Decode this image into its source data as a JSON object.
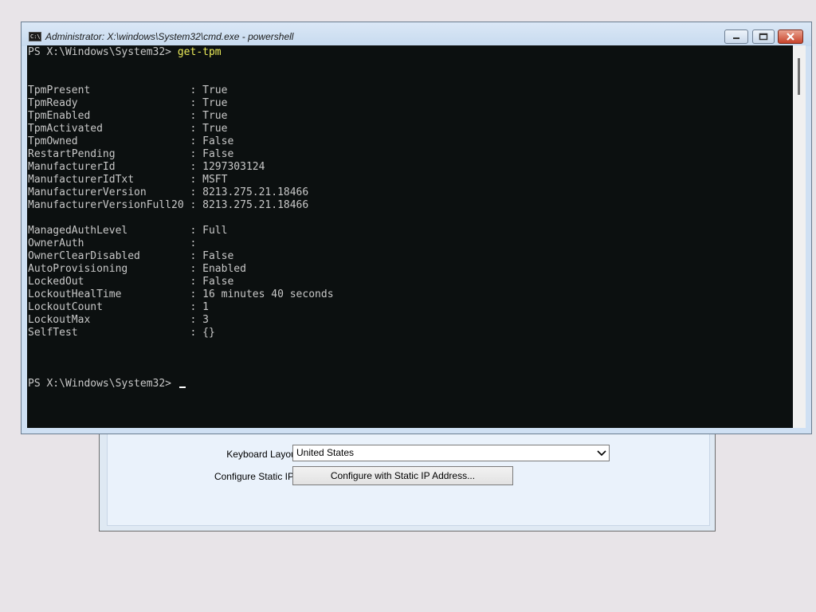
{
  "setup": {
    "keyboard_label": "Keyboard Layout",
    "keyboard_value": "United States",
    "static_ip_label": "Configure Static IP",
    "static_ip_button": "Configure with Static IP Address..."
  },
  "window": {
    "title": "Administrator: X:\\windows\\System32\\cmd.exe - powershell",
    "icon": "console-icon",
    "controls": [
      "minimize-icon",
      "maximize-icon",
      "close-icon"
    ]
  },
  "console": {
    "prompt": "PS X:\\Windows\\System32> ",
    "command": "get-tpm",
    "output_group1": [
      [
        "TpmPresent",
        "True"
      ],
      [
        "TpmReady",
        "True"
      ],
      [
        "TpmEnabled",
        "True"
      ],
      [
        "TpmActivated",
        "True"
      ],
      [
        "TpmOwned",
        "False"
      ],
      [
        "RestartPending",
        "False"
      ],
      [
        "ManufacturerId",
        "1297303124"
      ],
      [
        "ManufacturerIdTxt",
        "MSFT"
      ],
      [
        "ManufacturerVersion",
        "8213.275.21.18466"
      ],
      [
        "ManufacturerVersionFull20",
        "8213.275.21.18466"
      ]
    ],
    "output_group2": [
      [
        "ManagedAuthLevel",
        "Full"
      ],
      [
        "OwnerAuth",
        ""
      ],
      [
        "OwnerClearDisabled",
        "False"
      ],
      [
        "AutoProvisioning",
        "Enabled"
      ],
      [
        "LockedOut",
        "False"
      ],
      [
        "LockoutHealTime",
        "16 minutes 40 seconds"
      ],
      [
        "LockoutCount",
        "1"
      ],
      [
        "LockoutMax",
        "3"
      ],
      [
        "SelfTest",
        "{}"
      ]
    ],
    "final_prompt": "PS X:\\Windows\\System32> "
  },
  "colors": {
    "console_bg": "#0c1010",
    "console_text": "#c8c8c8",
    "command_text": "#ecec5a"
  }
}
